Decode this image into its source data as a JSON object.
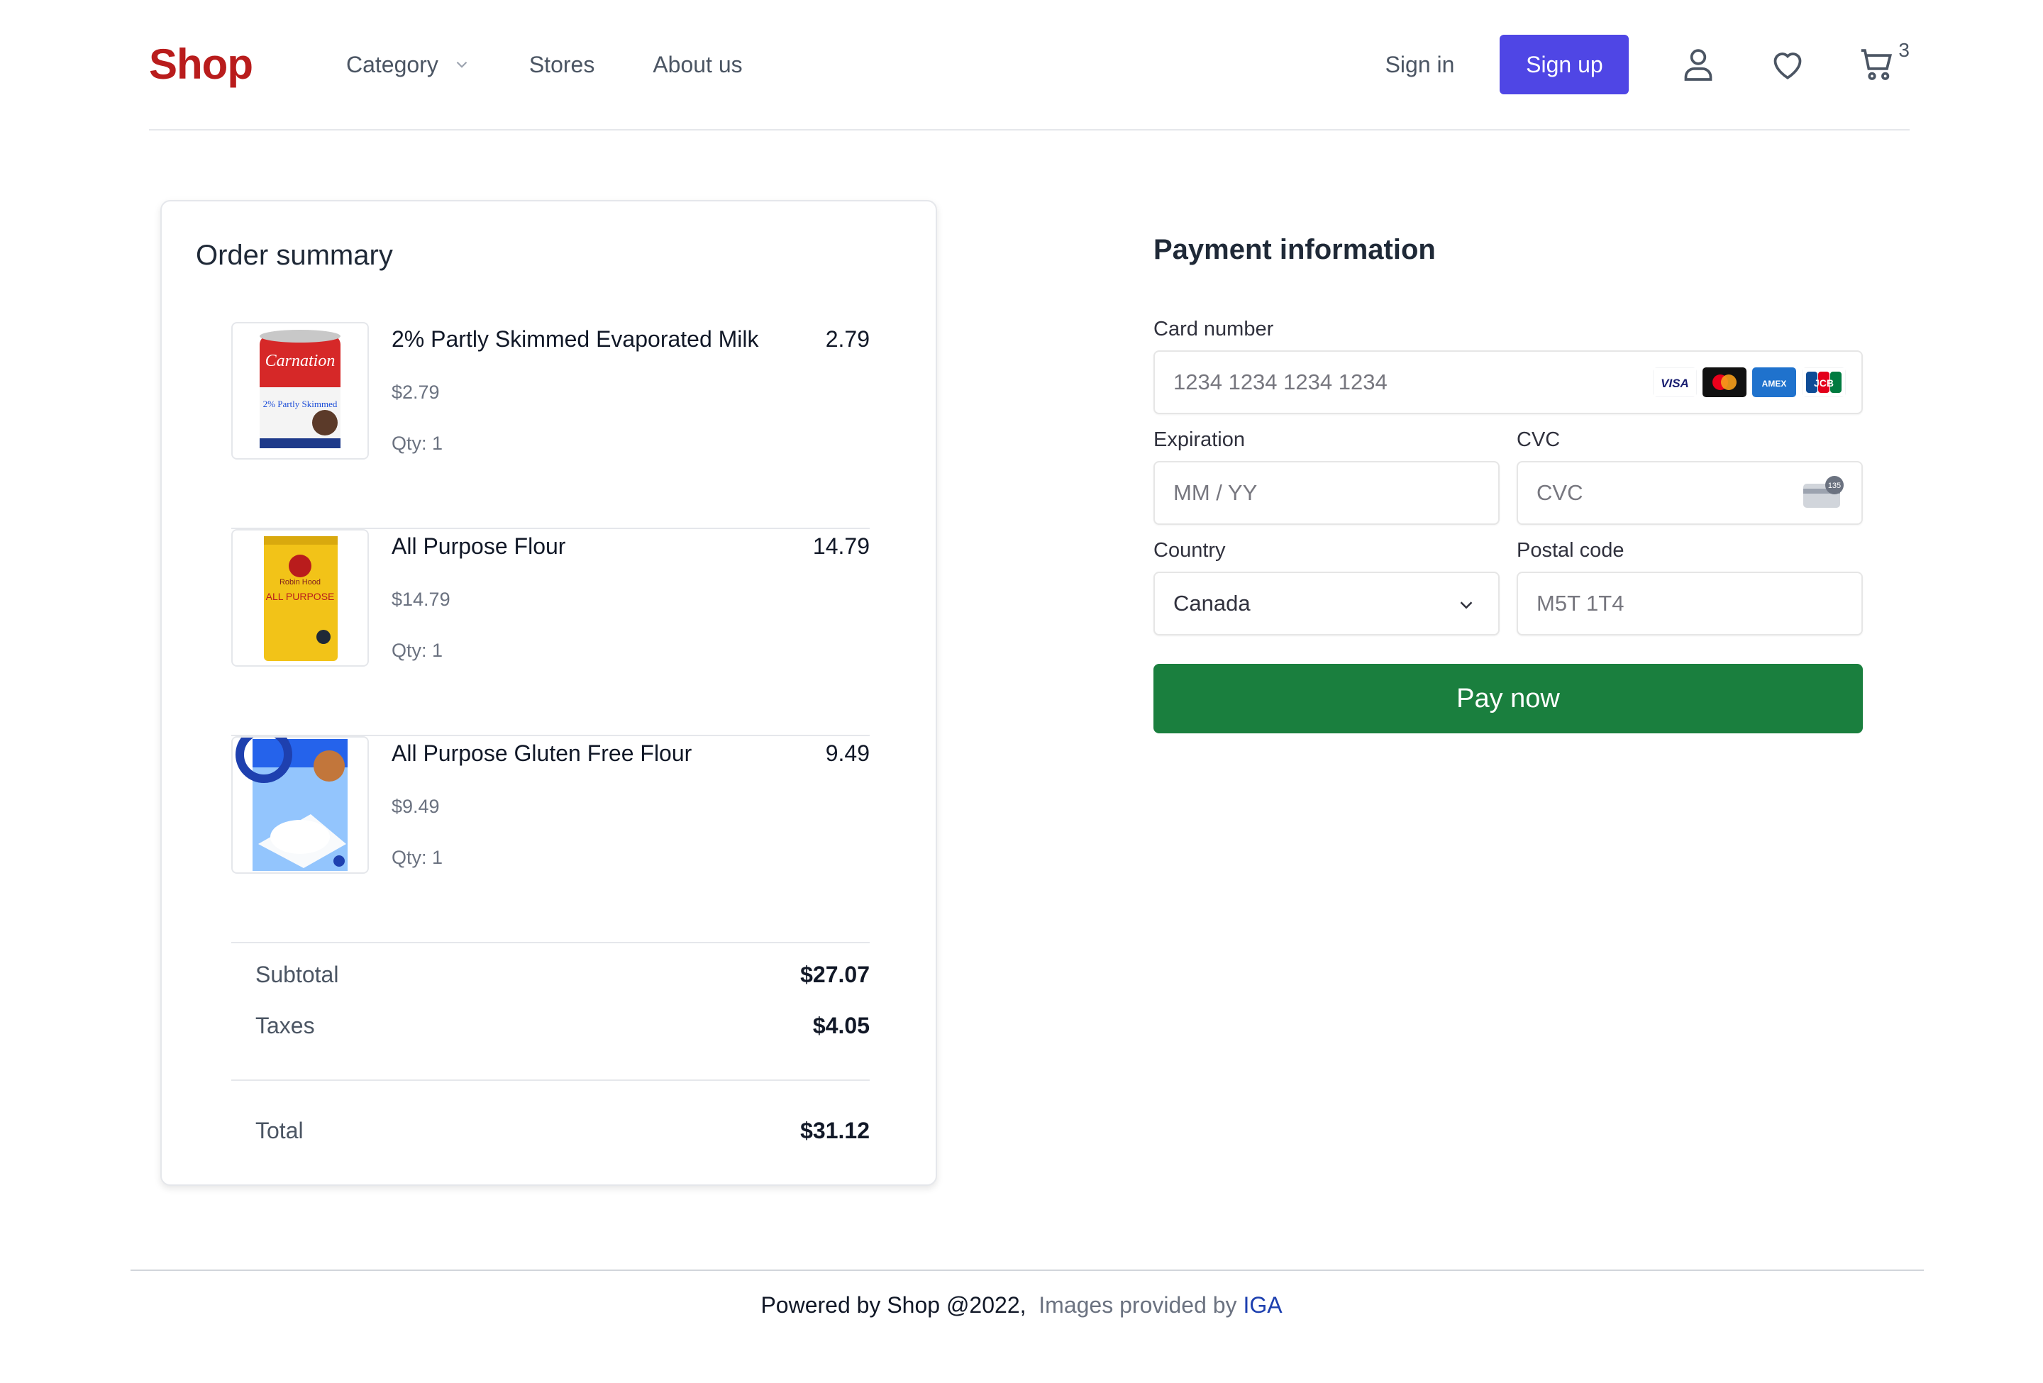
{
  "header": {
    "logo": "Shop",
    "nav": [
      {
        "label": "Category",
        "has_dropdown": true
      },
      {
        "label": "Stores"
      },
      {
        "label": "About us"
      }
    ],
    "sign_in": "Sign in",
    "sign_up": "Sign up",
    "cart_count": "3",
    "icons": [
      "user-icon",
      "heart-icon",
      "cart-icon"
    ]
  },
  "order": {
    "title": "Order summary",
    "items": [
      {
        "name": "2% Partly Skimmed Evaporated Milk",
        "total": "2.79",
        "price": "$2.79",
        "qty": "Qty: 1",
        "image": "evaporated-milk-can",
        "brand_text": "Carnation",
        "variant_text": "2% Partly Skimmed"
      },
      {
        "name": "All Purpose Flour",
        "total": "14.79",
        "price": "$14.79",
        "qty": "Qty: 1",
        "image": "flour-bag",
        "brand_text": "Robin Hood",
        "variant_text": "ALL PURPOSE"
      },
      {
        "name": "All Purpose Gluten Free Flour",
        "total": "9.49",
        "price": "$9.49",
        "qty": "Qty: 1",
        "image": "gluten-free-flour-box"
      }
    ],
    "subtotal_label": "Subtotal",
    "subtotal": "$27.07",
    "taxes_label": "Taxes",
    "taxes": "$4.05",
    "total_label": "Total",
    "total": "$31.12"
  },
  "payment": {
    "title": "Payment information",
    "card_number_label": "Card number",
    "card_number_placeholder": "1234 1234 1234 1234",
    "card_brands": [
      "VISA",
      "Mastercard",
      "AMEX",
      "JCB"
    ],
    "expiration_label": "Expiration",
    "expiration_placeholder": "MM / YY",
    "cvc_label": "CVC",
    "cvc_placeholder": "CVC",
    "cvc_hint": "135",
    "country_label": "Country",
    "country_value": "Canada",
    "postal_label": "Postal code",
    "postal_placeholder": "M5T 1T4",
    "pay_button": "Pay now"
  },
  "footer": {
    "powered": "Powered by Shop @2022,",
    "images": "Images provided by",
    "provider": "IGA"
  },
  "colors": {
    "brand": "#b91c1c",
    "primary": "#4f46e5",
    "pay": "#1a7f3e",
    "link": "#1e40af"
  }
}
